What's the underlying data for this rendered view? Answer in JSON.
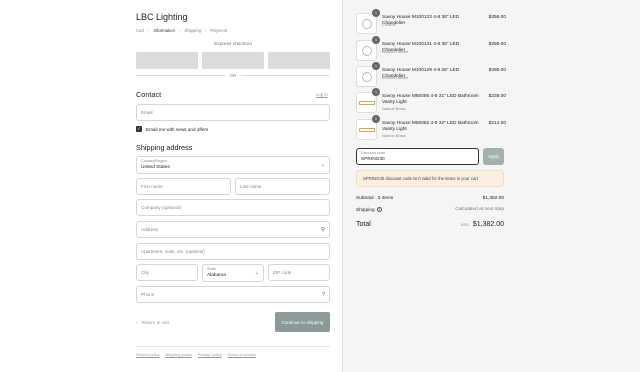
{
  "store": {
    "name": "LBC Lighting"
  },
  "breadcrumb": [
    "Cart",
    "Information",
    "Shipping",
    "Payment"
  ],
  "express": {
    "label": "Express checkout",
    "or": "OR"
  },
  "contact": {
    "title": "Contact",
    "login": "Log in",
    "email_placeholder": "Email",
    "newsletter_label": "Email me with news and offers",
    "newsletter_checked": true
  },
  "shipping": {
    "title": "Shipping address",
    "country_label": "Country/Region",
    "country_value": "United States",
    "first_name": "First name",
    "last_name": "Last name",
    "company": "Company (optional)",
    "address": "Address",
    "apartment": "Apartment, suite, etc. (optional)",
    "city": "City",
    "state_label": "State",
    "state_value": "Alabama",
    "zip": "ZIP code",
    "phone": "Phone"
  },
  "actions": {
    "return": "Return to cart",
    "continue": "Continue to shipping"
  },
  "footer": [
    "Refund policy",
    "Shipping policy",
    "Privacy policy",
    "Terms of service"
  ],
  "cart": {
    "items": [
      {
        "name": "Savoy House M100123 4-8 36\" LED Chandelier",
        "variant": "Chrome",
        "price": "$356.00",
        "qty": "1"
      },
      {
        "name": "Savoy House M100141 4-8 36\" LED Chandelier",
        "variant": "Brushed Nickel",
        "price": "$288.00",
        "qty": "1"
      },
      {
        "name": "Savoy House M100129 4-8 26\" LED Chandelier",
        "variant": "Brushed Nickel",
        "price": "$286.00",
        "qty": "1"
      },
      {
        "name": "Savoy House M80085 4-8 31\" LED Bathroom Vanity Light",
        "variant": "Natural Brass",
        "price": "$238.00",
        "qty": "1"
      },
      {
        "name": "Savoy House M80082 4-8 32\" LED Bathroom Vanity Light",
        "variant": "Natural Brass",
        "price": "$214.00",
        "qty": "1"
      }
    ],
    "discount_label": "Discount code",
    "discount_value": "SPRING30",
    "apply": "Apply",
    "warning": "SPRING30 discount code isn't valid for the items in your cart",
    "subtotal_label": "Subtotal · 5 items",
    "subtotal_value": "$1,382.00",
    "shipping_label": "Shipping",
    "shipping_value": "Calculated at next step",
    "total_label": "Total",
    "total_currency": "USD",
    "total_value": "$1,382.00"
  }
}
